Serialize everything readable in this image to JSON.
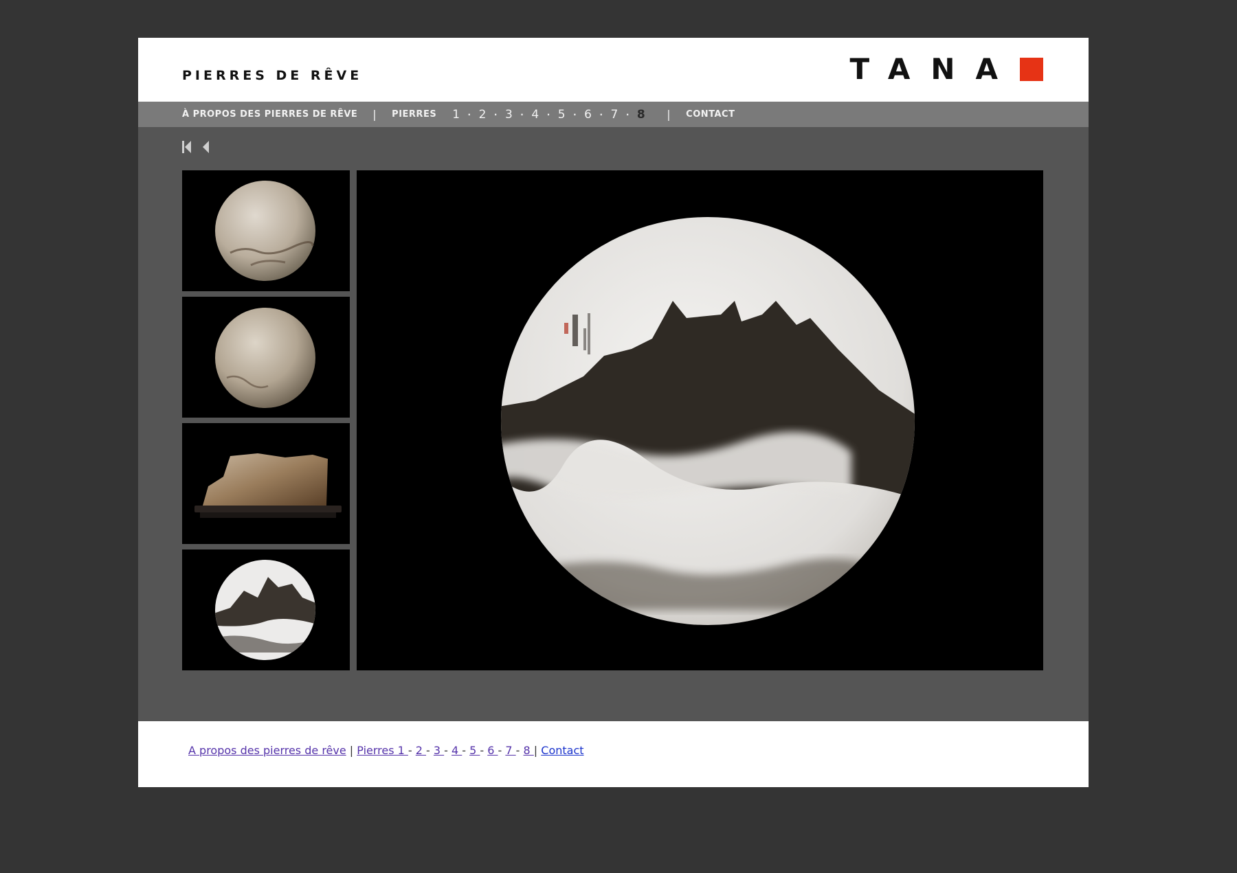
{
  "header": {
    "site_title": "PIERRES DE RÊVE",
    "logo_text": "TANA",
    "logo_color": "#e63315"
  },
  "nav": {
    "about": "À PROPOS DES PIERRES DE RÊVE",
    "separator": "|",
    "stones": "PIERRES",
    "pages": [
      "1",
      "2",
      "3",
      "4",
      "5",
      "6",
      "7",
      "8"
    ],
    "page_separator": "·",
    "active_page": "8",
    "contact": "CONTACT"
  },
  "pager": {
    "first_icon": "first-page-icon",
    "prev_icon": "previous-icon"
  },
  "thumbnails": [
    {
      "name": "round-stone-1"
    },
    {
      "name": "round-stone-2"
    },
    {
      "name": "rectangular-stone-on-stand"
    },
    {
      "name": "dreamstone-disc-mountains"
    }
  ],
  "footer": {
    "about": "A propos des pierres de rêve",
    "sep1": " | ",
    "stones": "Pierres 1 ",
    "dash": " - ",
    "pages": [
      "2 ",
      "3 ",
      "4 ",
      "5 ",
      "6 ",
      "7 ",
      "8 "
    ],
    "sep2": " | ",
    "contact": "Contact"
  }
}
